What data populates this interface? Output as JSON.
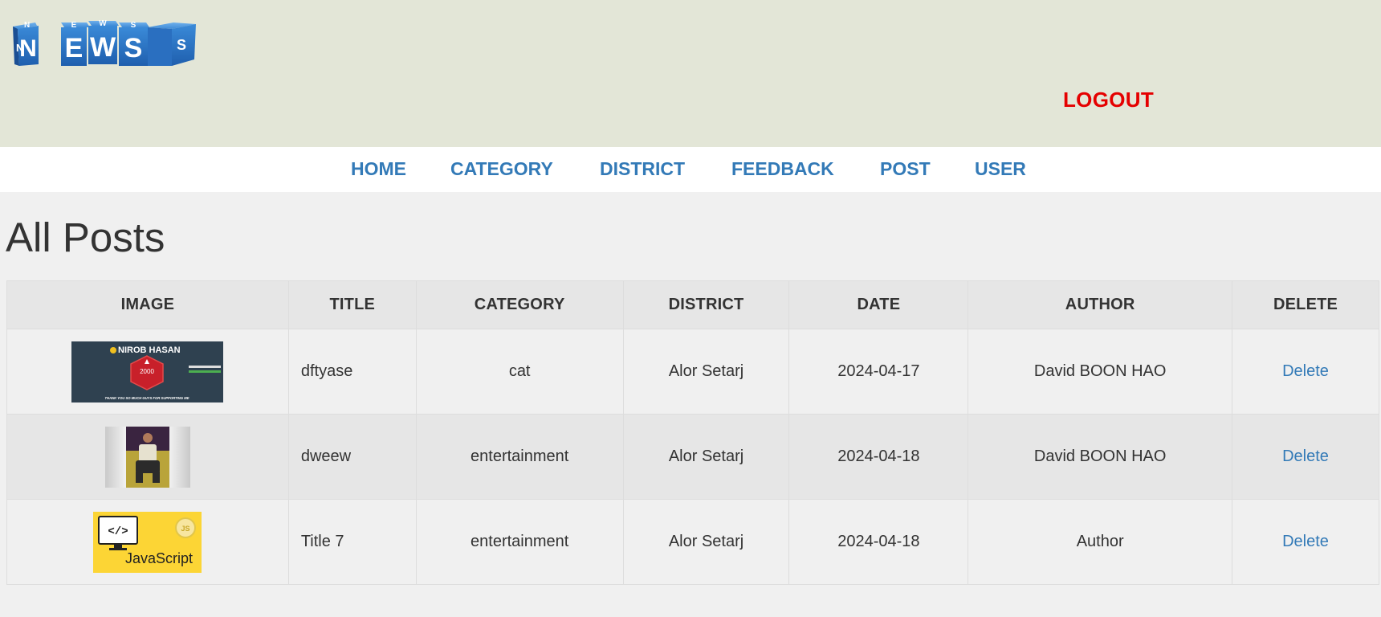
{
  "header": {
    "logo_letters_front": [
      "N",
      "E",
      "W",
      "S"
    ],
    "logo_letters_top": [
      "N",
      "E",
      "W",
      "S"
    ],
    "logo_letters_side": [
      "N",
      "S"
    ],
    "logout_label": "LOGOUT",
    "logout_color": "#e50000",
    "background": "#e3e6d7"
  },
  "nav": {
    "items": [
      {
        "label": "HOME"
      },
      {
        "label": "CATEGORY"
      },
      {
        "label": "DISTRICT"
      },
      {
        "label": "FEEDBACK"
      },
      {
        "label": "POST"
      },
      {
        "label": "USER"
      }
    ],
    "link_color": "#337ab7"
  },
  "main": {
    "title": "All Posts",
    "table": {
      "columns": [
        "IMAGE",
        "TITLE",
        "CATEGORY",
        "DISTRICT",
        "DATE",
        "AUTHOR",
        "DELETE"
      ],
      "rows": [
        {
          "image": {
            "kind": "banner",
            "text_name": "NIROB HASAN",
            "text_count": "2000",
            "text_caption": "THANK YOU SO MUCH GUYS FOR SUPPORTING ME"
          },
          "title": "dftyase",
          "category": "cat",
          "district": "Alor Setarj",
          "date": "2024-04-17",
          "author": "David BOON HAO",
          "delete_label": "Delete"
        },
        {
          "image": {
            "kind": "person-photo"
          },
          "title": "dweew",
          "category": "entertainment",
          "district": "Alor Setarj",
          "date": "2024-04-18",
          "author": "David BOON HAO",
          "delete_label": "Delete"
        },
        {
          "image": {
            "kind": "javascript-card",
            "text_code": "</>",
            "text_label": "JavaScript",
            "text_badge": "JS"
          },
          "title": "Title 7",
          "category": "entertainment",
          "district": "Alor Setarj",
          "date": "2024-04-18",
          "author": "Author",
          "delete_label": "Delete"
        }
      ]
    }
  }
}
